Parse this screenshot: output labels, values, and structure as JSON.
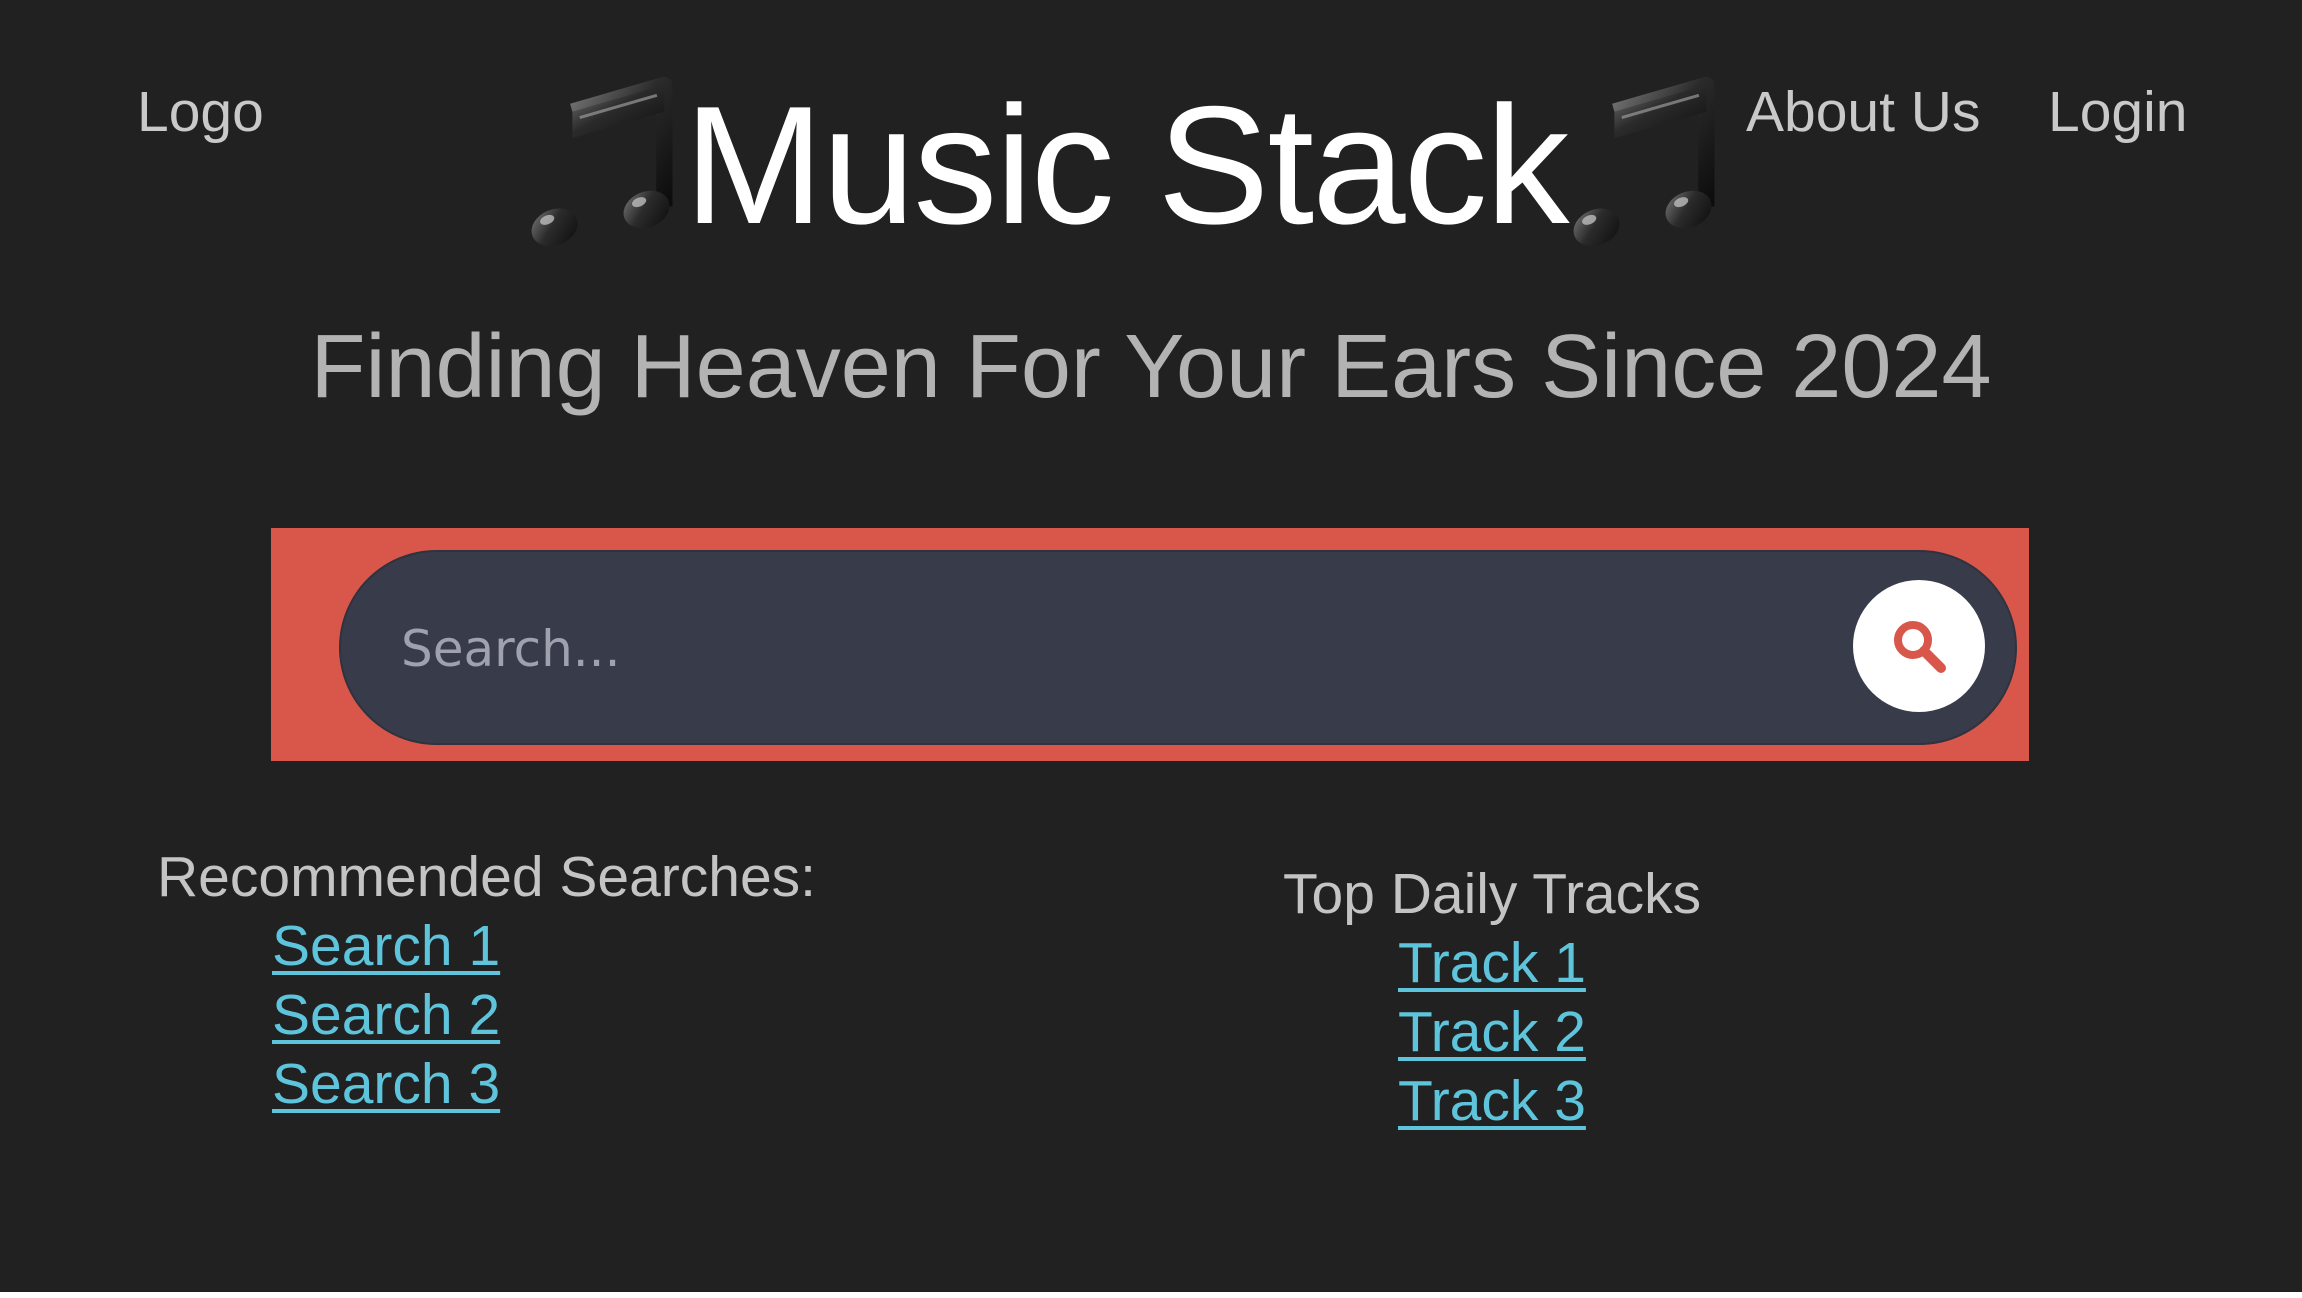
{
  "header": {
    "logo_label": "Logo",
    "title": "Music Stack",
    "title_icon": "musical-notes-emoji",
    "nav": [
      {
        "label": "About Us"
      },
      {
        "label": "Login"
      }
    ]
  },
  "hero": {
    "tagline": "Finding Heaven For Your Ears Since 2024"
  },
  "search": {
    "placeholder": "Search...",
    "value": "",
    "button_icon": "search-icon"
  },
  "recommended": {
    "heading": "Recommended Searches:",
    "items": [
      {
        "label": "Search 1"
      },
      {
        "label": "Search 2"
      },
      {
        "label": "Search 3"
      }
    ]
  },
  "top_tracks": {
    "heading": "Top Daily Tracks",
    "items": [
      {
        "label": "Track 1"
      },
      {
        "label": "Track 2"
      },
      {
        "label": "Track 3"
      }
    ]
  },
  "colors": {
    "background": "#212121",
    "search_banner": "#d9574a",
    "search_pill": "#383b4a",
    "link": "#5ec4dc",
    "search_icon": "#d9574a"
  }
}
